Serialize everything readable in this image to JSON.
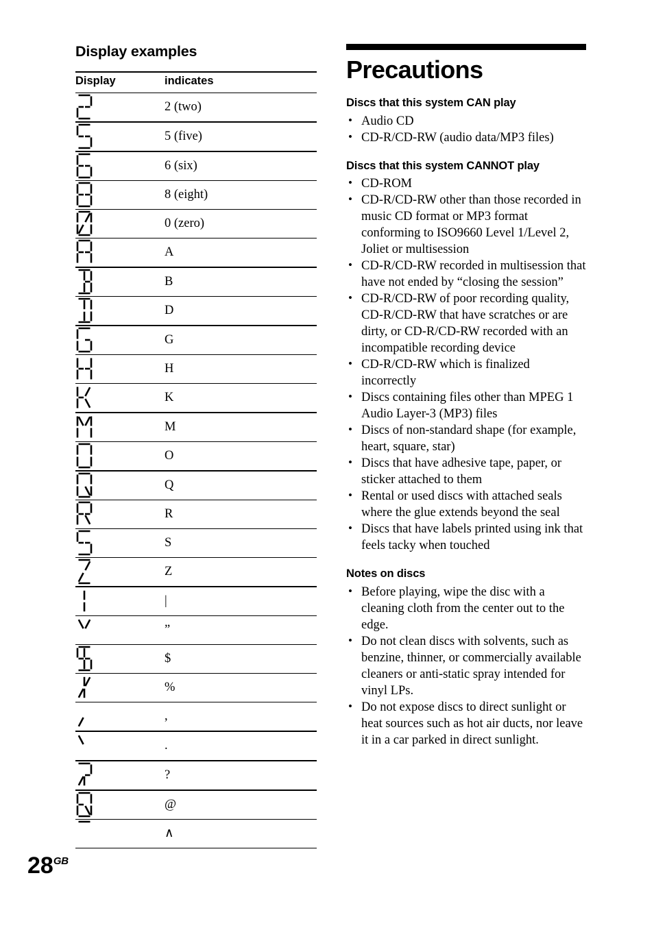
{
  "page": {
    "number": "28",
    "region_suffix": "GB"
  },
  "left_column": {
    "section_title": "Display examples",
    "table": {
      "headers": [
        "Display",
        "indicates"
      ],
      "rows": [
        {
          "glyph": "seg-2",
          "indicates": "2 (two)",
          "rule": "thick"
        },
        {
          "glyph": "seg-5",
          "indicates": "5 (five)",
          "rule": "thick"
        },
        {
          "glyph": "seg-6",
          "indicates": "6 (six)",
          "rule": "thin"
        },
        {
          "glyph": "seg-8",
          "indicates": "8 (eight)",
          "rule": "thin"
        },
        {
          "glyph": "seg-0",
          "indicates": "0 (zero)",
          "rule": "thin"
        },
        {
          "glyph": "seg-A",
          "indicates": "A",
          "rule": "thick"
        },
        {
          "glyph": "seg-B",
          "indicates": "B",
          "rule": "thin"
        },
        {
          "glyph": "seg-D",
          "indicates": "D",
          "rule": "thick"
        },
        {
          "glyph": "seg-G",
          "indicates": "G",
          "rule": "thin"
        },
        {
          "glyph": "seg-H",
          "indicates": "H",
          "rule": "thin"
        },
        {
          "glyph": "seg-K",
          "indicates": "K",
          "rule": "thick"
        },
        {
          "glyph": "seg-M",
          "indicates": "M",
          "rule": "thin"
        },
        {
          "glyph": "seg-O",
          "indicates": "O",
          "rule": "thick"
        },
        {
          "glyph": "seg-Q",
          "indicates": "Q",
          "rule": "thin"
        },
        {
          "glyph": "seg-R",
          "indicates": "R",
          "rule": "thin"
        },
        {
          "glyph": "seg-S",
          "indicates": "S",
          "rule": "thin"
        },
        {
          "glyph": "seg-Z",
          "indicates": "Z",
          "rule": "thick"
        },
        {
          "glyph": "seg-pipe",
          "indicates": "|",
          "rule": "thin"
        },
        {
          "glyph": "seg-quote",
          "indicates": "”",
          "rule": "thin"
        },
        {
          "glyph": "seg-dollar",
          "indicates": "$",
          "rule": "thin"
        },
        {
          "glyph": "seg-percent",
          "indicates": "%",
          "rule": "thin"
        },
        {
          "glyph": "seg-comma",
          "indicates": ",",
          "rule": "thick"
        },
        {
          "glyph": "seg-period",
          "indicates": ".",
          "rule": "thick"
        },
        {
          "glyph": "seg-quest",
          "indicates": "?",
          "rule": "thick"
        },
        {
          "glyph": "seg-at",
          "indicates": "@",
          "rule": "thin"
        },
        {
          "glyph": "seg-caret",
          "indicates": "∧",
          "rule": "thin"
        }
      ]
    }
  },
  "right_column": {
    "chapter_title": "Precautions",
    "sections": [
      {
        "heading": "Discs that this system CAN play",
        "items": [
          "Audio CD",
          "CD-R/CD-RW (audio data/MP3 files)"
        ]
      },
      {
        "heading": "Discs that this system CANNOT play",
        "items": [
          "CD-ROM",
          "CD-R/CD-RW other than those recorded in music CD format or MP3 format conforming to ISO9660 Level 1/Level 2, Joliet or multisession",
          "CD-R/CD-RW recorded in multisession that have not ended by “closing the session”",
          "CD-R/CD-RW of poor recording quality, CD-R/CD-RW that have scratches or are dirty, or CD-R/CD-RW recorded with an incompatible recording device",
          "CD-R/CD-RW which is finalized incorrectly",
          "Discs containing files other than MPEG 1 Audio Layer-3 (MP3) files",
          "Discs of non-standard shape (for example, heart, square, star)",
          "Discs that have adhesive tape, paper, or sticker attached to them",
          "Rental or used discs with attached seals where the glue extends beyond the seal",
          "Discs that have labels printed using ink that feels tacky when touched"
        ]
      },
      {
        "heading": "Notes on discs",
        "items": [
          "Before playing, wipe the disc with a cleaning cloth from the center out to the edge.",
          "Do not clean discs with solvents, such as benzine, thinner, or commercially available cleaners or anti-static spray intended for vinyl LPs.",
          "Do not expose discs to direct sunlight or heat sources such as hot air ducts, nor leave it in a car parked in direct sunlight."
        ]
      }
    ]
  }
}
